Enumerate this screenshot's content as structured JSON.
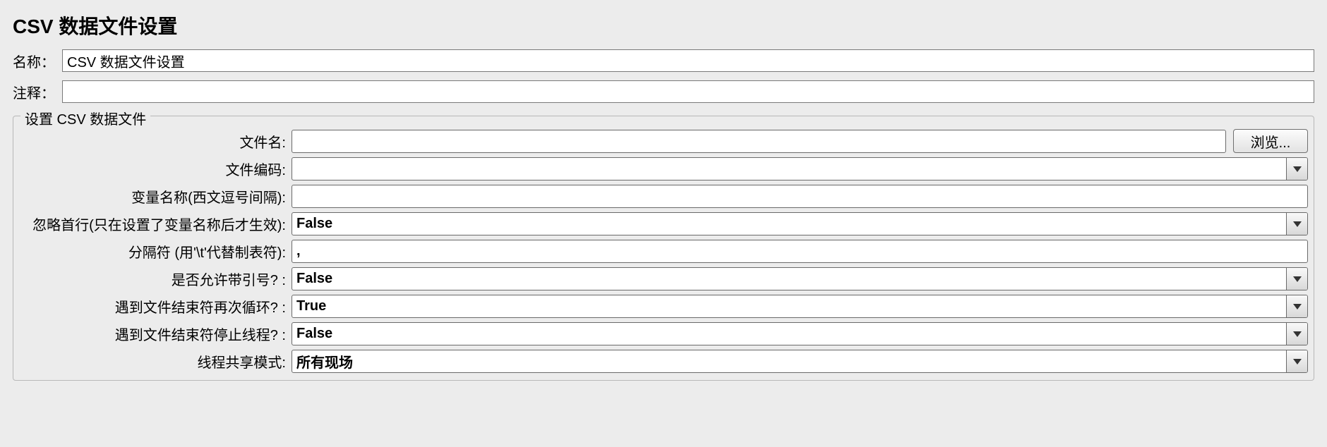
{
  "title": "CSV 数据文件设置",
  "top": {
    "name_label": "名称：",
    "name_value": "CSV 数据文件设置",
    "comment_label": "注释：",
    "comment_value": ""
  },
  "fieldset": {
    "legend": "设置 CSV 数据文件",
    "filename_label": "文件名:",
    "filename_value": "",
    "browse_label": "浏览...",
    "encoding_label": "文件编码:",
    "encoding_value": "",
    "varnames_label": "变量名称(西文逗号间隔):",
    "varnames_value": "",
    "ignore_first_label": "忽略首行(只在设置了变量名称后才生效):",
    "ignore_first_value": "False",
    "delimiter_label": "分隔符 (用'\\t'代替制表符):",
    "delimiter_value": ",",
    "allow_quote_label": "是否允许带引号? :",
    "allow_quote_value": "False",
    "recycle_label": "遇到文件结束符再次循环? :",
    "recycle_value": "True",
    "stop_thread_label": "遇到文件结束符停止线程? :",
    "stop_thread_value": "False",
    "share_mode_label": "线程共享模式:",
    "share_mode_value": "所有现场"
  }
}
